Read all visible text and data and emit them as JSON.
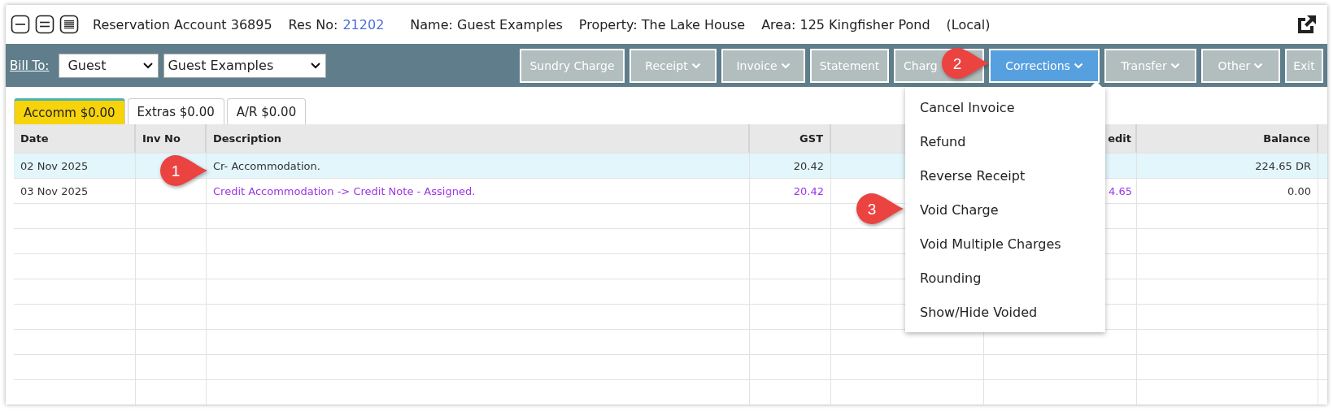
{
  "header": {
    "title": "Reservation Account 36895",
    "res_no_label": "Res No:",
    "res_no": "21202",
    "name": "Name: Guest Examples",
    "property": "Property: The Lake House",
    "area": "Area: 125 Kingfisher Pond",
    "scope": "(Local)"
  },
  "toolbar": {
    "bill_to_label": "Bill To:",
    "bill_to_type": "Guest",
    "bill_to_name": "Guest Examples",
    "buttons": [
      {
        "label": "Sundry Charge",
        "kind": "plain",
        "selected": false
      },
      {
        "label": "Receipt",
        "kind": "dropdown",
        "selected": false
      },
      {
        "label": "Invoice",
        "kind": "dropdown",
        "selected": false
      },
      {
        "label": "Statement",
        "kind": "plain",
        "selected": false
      },
      {
        "label": "Charg",
        "kind": "plain",
        "selected": false
      },
      {
        "label": "Corrections",
        "kind": "dropdown",
        "selected": true
      },
      {
        "label": "Transfer",
        "kind": "dropdown",
        "selected": false
      },
      {
        "label": "Other",
        "kind": "dropdown",
        "selected": false
      },
      {
        "label": "Exit",
        "kind": "plain",
        "selected": false
      }
    ]
  },
  "tabs": [
    {
      "label": "Accomm $0.00",
      "selected": true
    },
    {
      "label": "Extras $0.00",
      "selected": false
    },
    {
      "label": "A/R $0.00",
      "selected": false
    }
  ],
  "table": {
    "headers": {
      "date": "Date",
      "inv_no": "Inv No",
      "description": "Description",
      "gst": "GST",
      "column_6": "edit",
      "balance": "Balance"
    },
    "rows": [
      {
        "date": "02 Nov 2025",
        "description": "Cr- Accommodation.",
        "gst": "20.42",
        "balance": "224.65 DR",
        "selected": true,
        "kind": "normal"
      },
      {
        "date": "03 Nov 2025",
        "description": "Credit Accommodation -> Credit Note - Assigned.",
        "gst": "20.42",
        "column_6": "4.65",
        "balance": "0.00",
        "selected": false,
        "kind": "assigned"
      }
    ]
  },
  "corrections_menu": [
    "Cancel Invoice",
    "Refund",
    "Reverse Receipt",
    "Void Charge",
    "Void Multiple Charges",
    "Rounding",
    "Show/Hide Voided"
  ],
  "callouts": [
    "1",
    "2",
    "3"
  ]
}
